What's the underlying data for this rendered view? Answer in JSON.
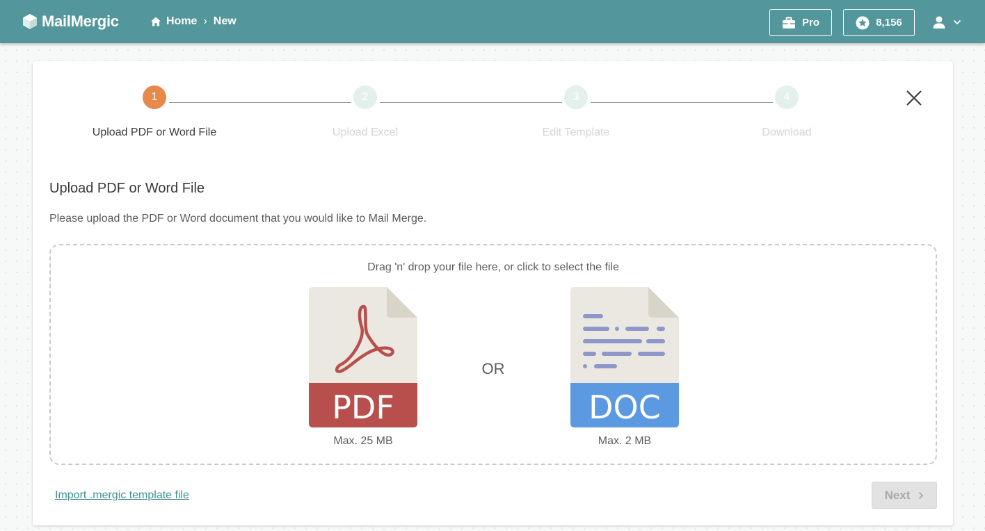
{
  "header": {
    "app_name": "MailMergic",
    "breadcrumb": {
      "home": "Home",
      "separator": "›",
      "current": "New"
    },
    "pro_label": "Pro",
    "credits": "8,156"
  },
  "stepper": {
    "steps": [
      {
        "number": "1",
        "label": "Upload PDF or Word File",
        "state": "active"
      },
      {
        "number": "2",
        "label": "Upload Excel",
        "state": "inactive"
      },
      {
        "number": "3",
        "label": "Edit Template",
        "state": "inactive"
      },
      {
        "number": "4",
        "label": "Download",
        "state": "inactive"
      }
    ]
  },
  "main": {
    "title": "Upload PDF or Word File",
    "description": "Please upload the PDF or Word document that you would like to Mail Merge.",
    "dropzone": {
      "hint": "Drag 'n' drop your file here, or click to select the file",
      "or_label": "OR",
      "pdf": {
        "badge": "PDF",
        "max_size": "Max. 25 MB",
        "icon": "pdf-file-icon"
      },
      "doc": {
        "badge": "DOC",
        "max_size": "Max. 2 MB",
        "icon": "doc-file-icon"
      }
    },
    "import_link": "Import .mergic template file",
    "next_label": "Next"
  },
  "colors": {
    "header_bg": "#53969b",
    "active_step": "#e6894a",
    "inactive_step": "#e3f0ee",
    "pdf_red": "#b84f4d",
    "doc_blue": "#5b99e0",
    "link": "#3f8f95"
  }
}
